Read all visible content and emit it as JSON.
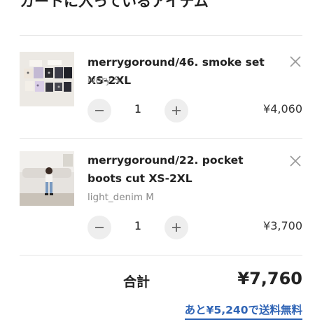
{
  "cart": {
    "title": "カートに入っているアイテム",
    "items": [
      {
        "name": "merrygoround/46. smoke set XS-2XL",
        "variant": "ivory S",
        "quantity": "1",
        "price": "¥4,060",
        "image": "smoke-set-product-photo"
      },
      {
        "name": "merrygoround/22. pocket boots cut XS-2XL",
        "variant": "light_denim M",
        "quantity": "1",
        "price": "¥3,700",
        "image": "child-in-denim-photo"
      }
    ],
    "total_label": "合計",
    "total_value": "¥7,760",
    "free_shipping_text": "あと¥5,240で送料無料"
  },
  "colors": {
    "link": "#2f64b5",
    "qty_button_bg": "#eeeeee",
    "divider": "#e5e5e5"
  }
}
